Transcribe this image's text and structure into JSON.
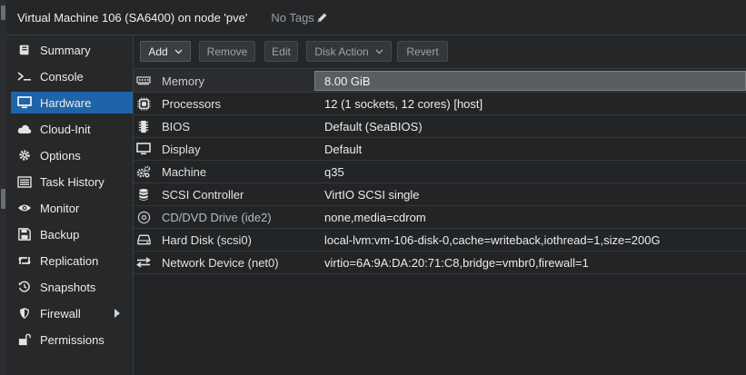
{
  "header": {
    "title": "Virtual Machine 106 (SA6400) on node 'pve'",
    "tags_label": "No Tags"
  },
  "sidebar": {
    "items": [
      {
        "label": "Summary",
        "icon": "book-icon"
      },
      {
        "label": "Console",
        "icon": "terminal-icon"
      },
      {
        "label": "Hardware",
        "icon": "monitor-icon",
        "active": true
      },
      {
        "label": "Cloud-Init",
        "icon": "cloud-icon"
      },
      {
        "label": "Options",
        "icon": "gear-icon"
      },
      {
        "label": "Task History",
        "icon": "list-icon"
      },
      {
        "label": "Monitor",
        "icon": "eye-icon"
      },
      {
        "label": "Backup",
        "icon": "floppy-icon"
      },
      {
        "label": "Replication",
        "icon": "retweet-icon"
      },
      {
        "label": "Snapshots",
        "icon": "history-icon"
      },
      {
        "label": "Firewall",
        "icon": "shield-icon",
        "has_submenu": true
      },
      {
        "label": "Permissions",
        "icon": "unlock-icon"
      }
    ]
  },
  "toolbar": {
    "add_label": "Add",
    "remove_label": "Remove",
    "edit_label": "Edit",
    "disk_action_label": "Disk Action",
    "revert_label": "Revert"
  },
  "hardware": {
    "rows": [
      {
        "key": "Memory",
        "value": "8.00 GiB",
        "icon": "memory-icon",
        "selected": true
      },
      {
        "key": "Processors",
        "value": "12 (1 sockets, 12 cores) [host]",
        "icon": "cpu-icon"
      },
      {
        "key": "BIOS",
        "value": "Default (SeaBIOS)",
        "icon": "chip-icon"
      },
      {
        "key": "Display",
        "value": "Default",
        "icon": "desktop-icon"
      },
      {
        "key": "Machine",
        "value": "q35",
        "icon": "cogs-icon"
      },
      {
        "key": "SCSI Controller",
        "value": "VirtIO SCSI single",
        "icon": "database-icon"
      },
      {
        "key": "CD/DVD Drive (ide2)",
        "value": "none,media=cdrom",
        "icon": "cdrom-icon"
      },
      {
        "key": "Hard Disk (scsi0)",
        "value": "local-lvm:vm-106-disk-0,cache=writeback,iothread=1,size=200G",
        "icon": "hdd-icon"
      },
      {
        "key": "Network Device (net0)",
        "value": "virtio=6A:9A:DA:20:71:C8,bridge=vmbr0,firewall=1",
        "icon": "exchange-icon"
      }
    ]
  },
  "colors": {
    "accent": "#1f63a8",
    "background": "#222426",
    "selected_value_bg": "#5a5d61"
  }
}
